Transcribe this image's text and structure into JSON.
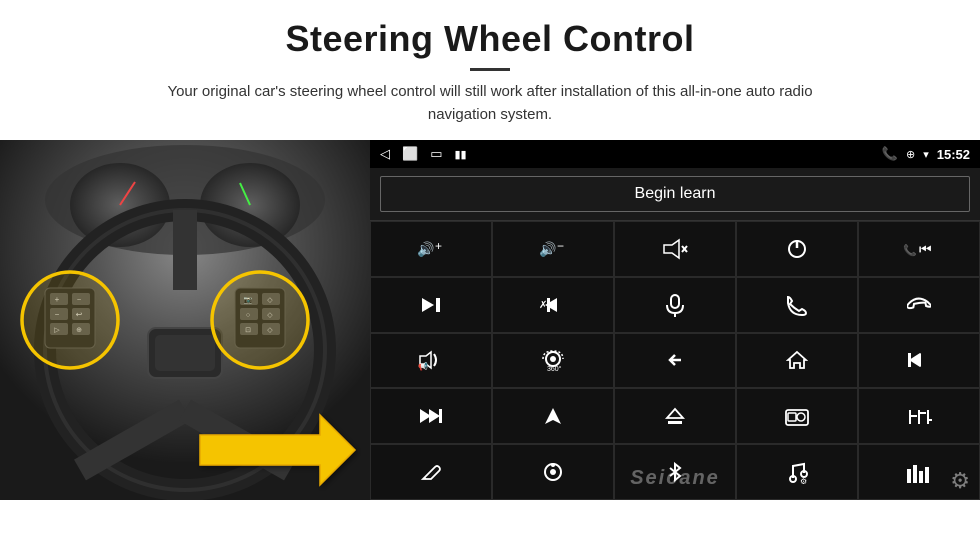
{
  "header": {
    "title": "Steering Wheel Control",
    "divider": true,
    "subtitle": "Your original car's steering wheel control will still work after installation of this all-in-one auto radio navigation system."
  },
  "status_bar": {
    "time": "15:52",
    "left_icons": [
      "back-arrow",
      "home-rect",
      "square-outline",
      "signal-bars"
    ],
    "right_icons": [
      "phone-icon",
      "location-icon",
      "wifi-icon"
    ]
  },
  "begin_learn": {
    "label": "Begin learn"
  },
  "grid_icons": [
    [
      "vol-up",
      "vol-down",
      "mute",
      "power",
      "prev-track-phone"
    ],
    [
      "skip-next",
      "skip-prev-x",
      "mic",
      "phone-call",
      "phone-end"
    ],
    [
      "speaker",
      "360-cam",
      "back",
      "home",
      "skip-back"
    ],
    [
      "fast-forward",
      "navigate",
      "eject",
      "radio",
      "equalizer"
    ],
    [
      "mic-alt",
      "settings-knob",
      "bluetooth",
      "music-note",
      "equalizer-alt"
    ]
  ],
  "grid_symbols": [
    [
      "🔊+",
      "🔊-",
      "🔇",
      "⏻",
      "📞⏮"
    ],
    [
      "⏭",
      "⏪×",
      "🎤",
      "📞",
      "📞↩"
    ],
    [
      "📢",
      "🔄",
      "↩",
      "🏠",
      "⏮⏮"
    ],
    [
      "⏩⏩",
      "▶",
      "⏏",
      "📻",
      "⚙"
    ],
    [
      "🎤",
      "⚙",
      "✱",
      "🎵",
      "📊"
    ]
  ],
  "seicane": {
    "watermark": "Seicane"
  },
  "colors": {
    "background": "#ffffff",
    "android_bg": "#111111",
    "statusbar_bg": "#000000",
    "grid_border": "#2a2a2a",
    "begin_learn_border": "#666666",
    "highlight_yellow": "#f5c400",
    "text_primary": "#1a1a1a"
  }
}
